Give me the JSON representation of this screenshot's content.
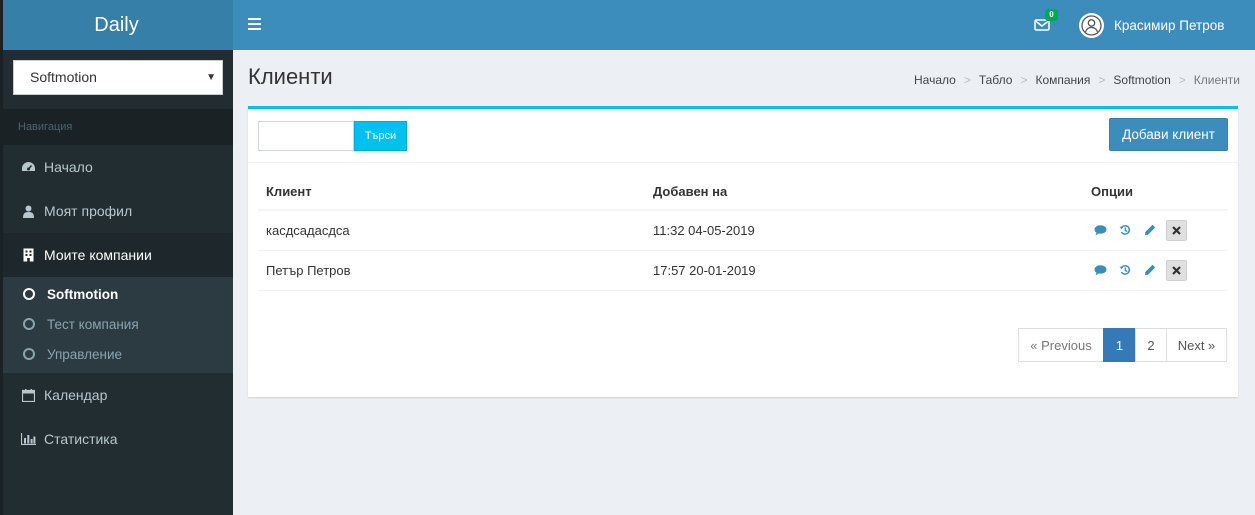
{
  "app": {
    "name": "Daily"
  },
  "sidebar": {
    "company_select": {
      "value": "Softmotion"
    },
    "nav_header": "Навигация",
    "items": [
      {
        "label": "Начало",
        "icon": "dashboard-icon"
      },
      {
        "label": "Моят профил",
        "icon": "user-icon"
      },
      {
        "label": "Моите компании",
        "icon": "building-icon"
      },
      {
        "label": "Календар",
        "icon": "calendar-icon"
      },
      {
        "label": "Статистика",
        "icon": "bar-chart-icon"
      }
    ],
    "submenu": [
      {
        "label": "Softmotion"
      },
      {
        "label": "Тест компания"
      },
      {
        "label": "Управление"
      }
    ]
  },
  "navbar": {
    "mail_count": "0",
    "user_name": "Красимир Петров"
  },
  "header": {
    "title": "Клиенти",
    "breadcrumb": [
      "Начало",
      "Табло",
      "Компания",
      "Softmotion",
      "Клиенти"
    ]
  },
  "toolbar": {
    "search_value": "",
    "search_label": "Търси",
    "add_label": "Добави клиент"
  },
  "table": {
    "columns": [
      "Клиент",
      "Добавен на",
      "Опции"
    ],
    "rows": [
      {
        "client": "касдсадасдса",
        "added": "11:32 04-05-2019"
      },
      {
        "client": "Петър Петров",
        "added": "17:57 20-01-2019"
      }
    ]
  },
  "pagination": {
    "prev": "« Previous",
    "pages": [
      "1",
      "2"
    ],
    "next": "Next »"
  },
  "colors": {
    "brand_dark": "#367fa9",
    "brand": "#3c8dbc",
    "info": "#00c0ef",
    "sidebar_bg": "#222d32",
    "badge": "#00a65a"
  }
}
